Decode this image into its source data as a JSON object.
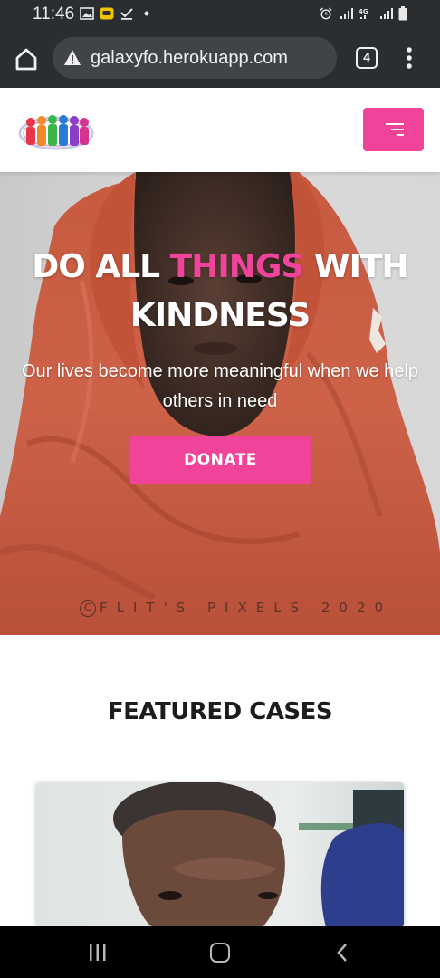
{
  "status_bar": {
    "time": "11:46",
    "left_icons": [
      "image-icon",
      "notification-app-icon",
      "download-done-icon",
      "dot-icon"
    ],
    "right_icons": [
      "alarm-icon",
      "signal-icon",
      "4g-signal-icon",
      "battery-icon"
    ],
    "network_label": "4G"
  },
  "browser": {
    "url": "galaxyfo.herokuapp.com",
    "tab_count": "4",
    "security_icon": "warning-icon"
  },
  "header": {
    "logo_icon": "people-circle-logo-icon",
    "menu_icon": "hamburger-icon",
    "accent_color": "#f0449a"
  },
  "hero": {
    "title_part1": "DO ALL ",
    "title_accent": "THINGS",
    "title_part2": " WITH KINDNESS",
    "subtitle": "Our lives become more meaningful when we help others in need",
    "donate_label": "DONATE",
    "watermark_symbol": "C",
    "watermark": "FLIT'S PIXELS 2020"
  },
  "featured": {
    "title": "FEATURED CASES"
  },
  "nav": {
    "icons": [
      "recents-icon",
      "home-icon",
      "back-icon"
    ]
  }
}
